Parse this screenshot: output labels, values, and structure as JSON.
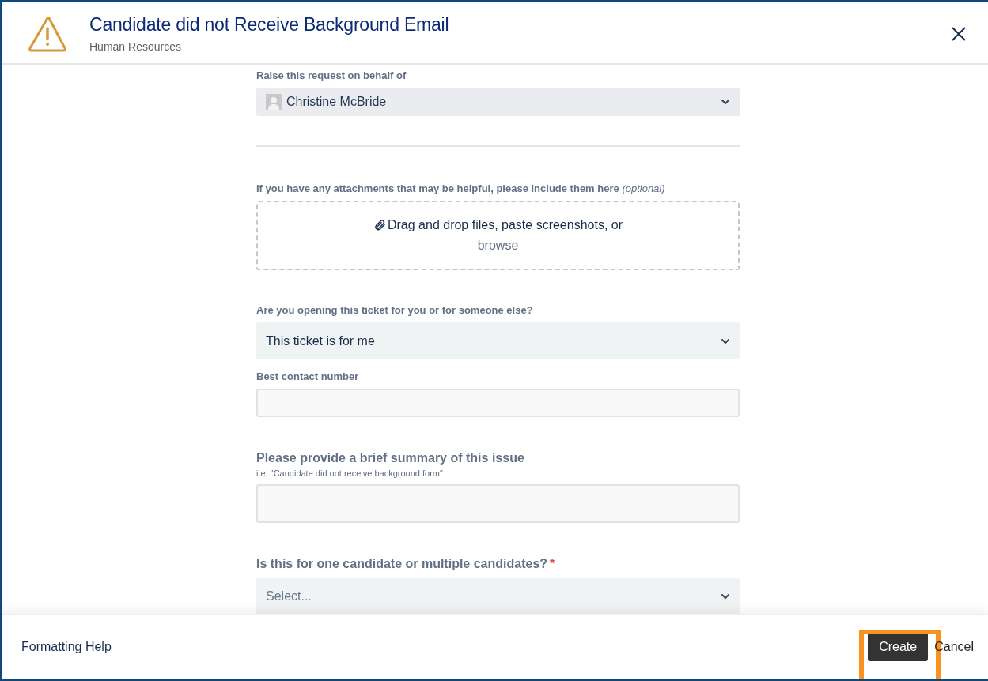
{
  "header": {
    "title": "Candidate did not Receive Background Email",
    "subtitle": "Human Resources"
  },
  "fields": [
    {
      "kind": "user-select",
      "label": "Raise this request on behalf of",
      "value": "Christine McBride",
      "prominent": false
    },
    {
      "kind": "divider"
    },
    {
      "kind": "dropzone",
      "label": "If you have any attachments that may be helpful, please include them here",
      "optional_note": "(optional)",
      "text": "Drag and drop files, paste screenshots, or",
      "link": "browse",
      "prominent": false
    },
    {
      "kind": "select",
      "label": "Are you opening this ticket for you or for someone else?",
      "value": "This ticket is for me",
      "prominent": false
    },
    {
      "kind": "text",
      "label": "Best contact number",
      "prominent": false
    },
    {
      "kind": "text",
      "label": "Please provide a brief summary of this issue",
      "hint": "i.e. \"Candidate did not receive background form\"",
      "prominent": true
    },
    {
      "kind": "select",
      "label": "Is this for one candidate or multiple candidates?",
      "required_mark": "*",
      "placeholder": "Select...",
      "prominent": true
    }
  ],
  "footer": {
    "help_link": "Formatting Help",
    "buttons": [
      {
        "label": "Create",
        "kind": "primary",
        "highlighted": true
      },
      {
        "label": "Cancel",
        "kind": "link",
        "highlighted": false
      }
    ]
  }
}
